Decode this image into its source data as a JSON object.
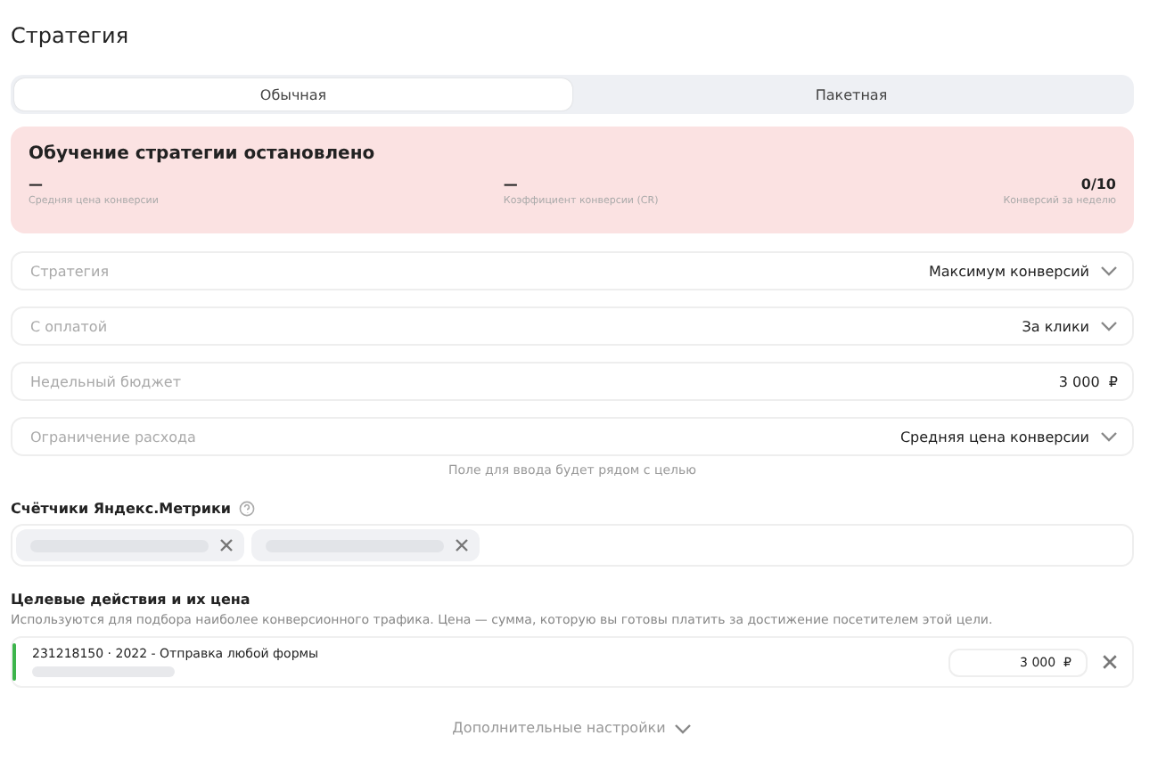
{
  "title": "Стратегия",
  "tabs": [
    {
      "label": "Обычная",
      "selected": true
    },
    {
      "label": "Пакетная",
      "selected": false
    }
  ],
  "alert": {
    "title": "Обучение стратегии остановлено",
    "stats": [
      {
        "value": "—",
        "label": "Средняя цена конверсии"
      },
      {
        "value": "—",
        "label": "Коэффициент конверсии (CR)"
      },
      {
        "value": "0/10",
        "label": "Конверсий за неделю"
      }
    ]
  },
  "fields": [
    {
      "kind": "select",
      "label": "Стратегия",
      "value": "Максимум конверсий"
    },
    {
      "kind": "select",
      "label": "С оплатой",
      "value": "За клики"
    },
    {
      "kind": "input",
      "label": "Недельный бюджет",
      "value": "3 000  ₽"
    },
    {
      "kind": "select",
      "label": "Ограничение расхода",
      "value": "Средняя цена конверсии"
    }
  ],
  "field_hint": "Поле для ввода будет рядом с целью",
  "counters": {
    "label": "Счётчики Яндекс.Метрики",
    "chips": [
      {
        "kind": "redacted"
      },
      {
        "kind": "redacted"
      }
    ]
  },
  "goals": {
    "title": "Целевые действия и их цена",
    "description": "Используются для подбора наиболее конверсионного трафика. Цена — сумма, которую вы готовы платить за достижение посетителем этой цели.",
    "items": [
      {
        "name": "231218150 · 2022 - Отправка любой формы",
        "price": "3 000  ₽",
        "color": "#3cb44b"
      }
    ]
  },
  "more_settings": "Дополнительные настройки"
}
